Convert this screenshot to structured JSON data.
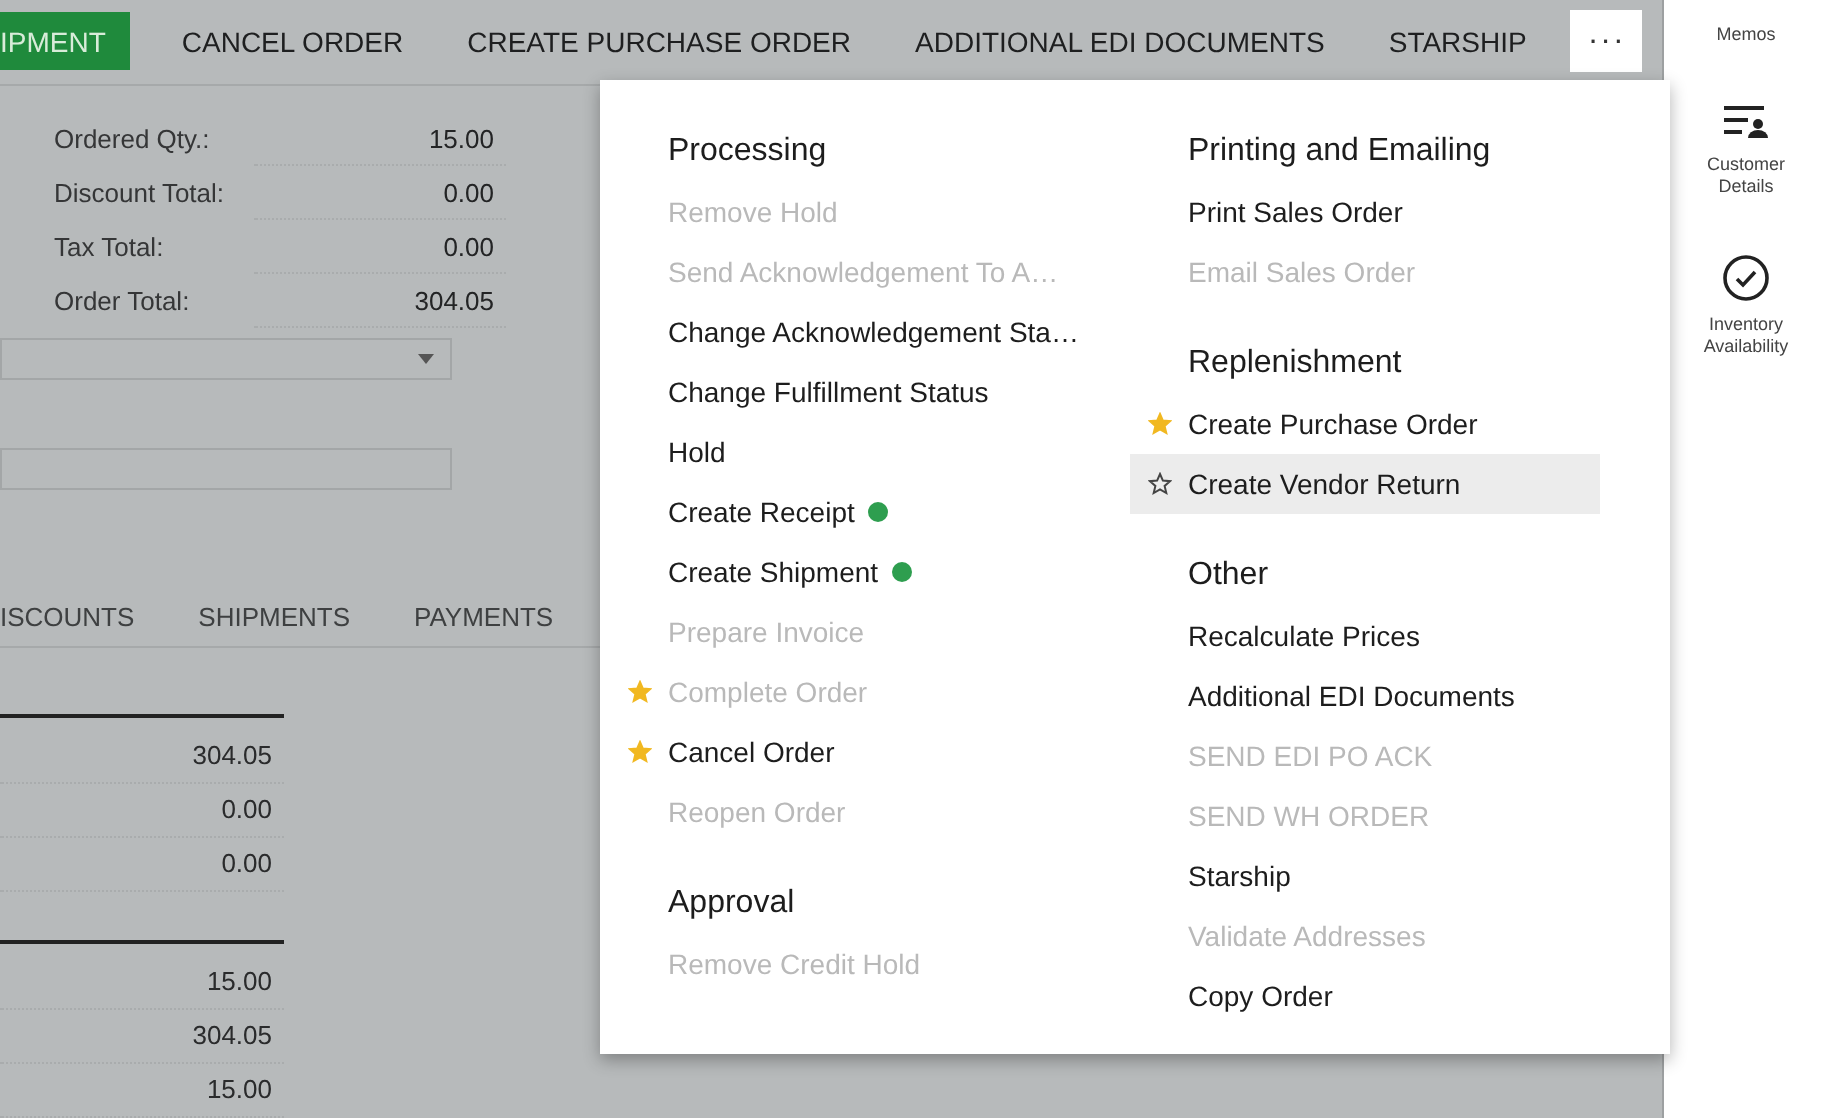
{
  "toolbar": [
    {
      "label": "IPMENT",
      "primary": true
    },
    {
      "label": "CANCEL ORDER",
      "primary": false
    },
    {
      "label": "CREATE PURCHASE ORDER",
      "primary": false
    },
    {
      "label": "ADDITIONAL EDI DOCUMENTS",
      "primary": false
    },
    {
      "label": "STARSHIP",
      "primary": false
    }
  ],
  "more_button": {
    "label": "···",
    "expanded": true
  },
  "totals": [
    {
      "label": "Ordered Qty.:",
      "value": "15.00"
    },
    {
      "label": "Discount Total:",
      "value": "0.00"
    },
    {
      "label": "Tax Total:",
      "value": "0.00"
    },
    {
      "label": "Order Total:",
      "value": "304.05"
    }
  ],
  "tabs": [
    {
      "label": "ISCOUNTS",
      "selected": false
    },
    {
      "label": "SHIPMENTS",
      "selected": false
    },
    {
      "label": "PAYMENTS",
      "selected": false
    }
  ],
  "summary_groups": [
    {
      "values": [
        "304.05",
        "0.00",
        "0.00"
      ]
    },
    {
      "values": [
        "15.00",
        "304.05",
        "15.00"
      ]
    }
  ],
  "menu": {
    "columns": [
      {
        "sections": [
          {
            "title": "Processing",
            "items": [
              {
                "label": "Remove Hold",
                "disabled": true,
                "starred": false,
                "highlighted": false
              },
              {
                "label": "Send Acknowledgement To A…",
                "disabled": true,
                "starred": false,
                "highlighted": false
              },
              {
                "label": "Change Acknowledgement Sta…",
                "disabled": false,
                "starred": false,
                "highlighted": false
              },
              {
                "label": "Change Fulfillment Status",
                "disabled": false,
                "starred": false,
                "highlighted": false
              },
              {
                "label": "Hold",
                "disabled": false,
                "starred": false,
                "highlighted": false
              },
              {
                "label": "Create Receipt",
                "disabled": false,
                "starred": false,
                "highlighted": false,
                "color": "#2e9e4f"
              },
              {
                "label": "Create Shipment",
                "disabled": false,
                "starred": false,
                "highlighted": false,
                "color": "#2e9e4f"
              },
              {
                "label": "Prepare Invoice",
                "disabled": true,
                "starred": false,
                "highlighted": false
              },
              {
                "label": "Complete Order",
                "disabled": true,
                "starred": true,
                "highlighted": false
              },
              {
                "label": "Cancel Order",
                "disabled": false,
                "starred": true,
                "highlighted": false
              },
              {
                "label": "Reopen Order",
                "disabled": true,
                "starred": false,
                "highlighted": false
              }
            ]
          },
          {
            "title": "Approval",
            "items": [
              {
                "label": "Remove Credit Hold",
                "disabled": true,
                "starred": false,
                "highlighted": false
              }
            ]
          }
        ]
      },
      {
        "sections": [
          {
            "title": "Printing and Emailing",
            "items": [
              {
                "label": "Print Sales Order",
                "disabled": false,
                "starred": false,
                "highlighted": false
              },
              {
                "label": "Email Sales Order",
                "disabled": true,
                "starred": false,
                "highlighted": false
              }
            ]
          },
          {
            "title": "Replenishment",
            "items": [
              {
                "label": "Create Purchase Order",
                "disabled": false,
                "starred": true,
                "highlighted": false
              },
              {
                "label": "Create Vendor Return",
                "disabled": false,
                "starred": false,
                "highlighted": true
              }
            ]
          },
          {
            "title": "Other",
            "items": [
              {
                "label": "Recalculate Prices",
                "disabled": false,
                "starred": false,
                "highlighted": false
              },
              {
                "label": "Additional EDI Documents",
                "disabled": false,
                "starred": false,
                "highlighted": false
              },
              {
                "label": "SEND EDI PO ACK",
                "disabled": true,
                "starred": false,
                "highlighted": false
              },
              {
                "label": "SEND WH ORDER",
                "disabled": true,
                "starred": false,
                "highlighted": false
              },
              {
                "label": "Starship",
                "disabled": false,
                "starred": false,
                "highlighted": false
              },
              {
                "label": "Validate Addresses",
                "disabled": true,
                "starred": false,
                "highlighted": false
              },
              {
                "label": "Copy Order",
                "disabled": false,
                "starred": false,
                "highlighted": false
              }
            ]
          }
        ]
      }
    ]
  },
  "sidebar": {
    "items": [
      {
        "kind": "invoices",
        "label": "Memos"
      },
      {
        "kind": "customer",
        "label": "Customer Details"
      },
      {
        "kind": "inventory",
        "label": "Inventory Availability"
      }
    ]
  }
}
